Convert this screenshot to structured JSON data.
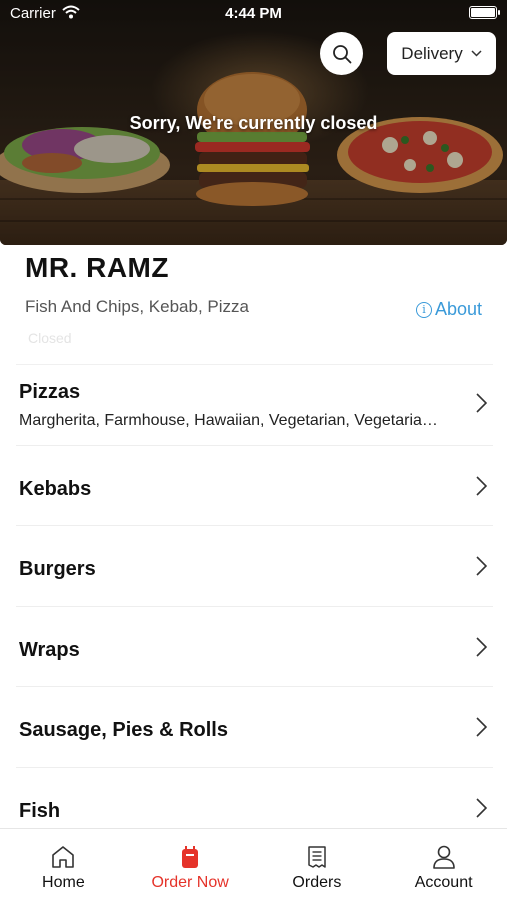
{
  "status_bar": {
    "carrier": "Carrier",
    "time": "4:44 PM"
  },
  "header": {
    "delivery_label": "Delivery",
    "closed_message": "Sorry, We're currently closed"
  },
  "restaurant": {
    "name": "MR. RAMZ",
    "cuisines": "Fish And Chips, Kebab, Pizza",
    "about_label": "About",
    "status": "Closed"
  },
  "menu": {
    "categories": [
      {
        "title": "Pizzas",
        "subtitle": "Margherita, Farmhouse, Hawaiian, Vegetarian, Vegetarian Supreme"
      },
      {
        "title": "Kebabs",
        "subtitle": ""
      },
      {
        "title": "Burgers",
        "subtitle": ""
      },
      {
        "title": "Wraps",
        "subtitle": ""
      },
      {
        "title": "Sausage, Pies & Rolls",
        "subtitle": ""
      },
      {
        "title": "Fish",
        "subtitle": ""
      }
    ]
  },
  "tabbar": {
    "tabs": [
      {
        "label": "Home",
        "icon": "home-icon",
        "active": false
      },
      {
        "label": "Order Now",
        "icon": "order-bag-icon",
        "active": true
      },
      {
        "label": "Orders",
        "icon": "receipt-icon",
        "active": false
      },
      {
        "label": "Account",
        "icon": "person-icon",
        "active": false
      }
    ]
  },
  "colors": {
    "accent": "#e5332a",
    "link": "#3a9ad9"
  }
}
